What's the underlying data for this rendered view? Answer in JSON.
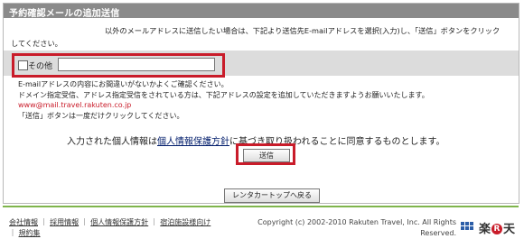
{
  "section": {
    "title": "予約確認メールの追加送信",
    "intro_line1": "以外のメールアドレスに送信したい場合は、下記より送信先E-mailアドレスを選択(入力)し、「送信」ボタンをクリック",
    "intro_line2": "してください。"
  },
  "other_option": {
    "label": "その他",
    "value": "",
    "checked": false
  },
  "notes": {
    "line1": "E-mailアドレスの内容にお間違いがないかよくご確認ください。",
    "line2": "ドメイン指定受信、アドレス指定受信をされている方は、下記アドレスの設定を追加していただきますようお願いいたします。",
    "email": "www@mail.travel.rakuten.co.jp",
    "line4": "「送信」ボタンは一度だけクリックしてください。"
  },
  "consent": {
    "before": "入力された個人情報は",
    "link": "個人情報保護方針",
    "after": "に基づき取り扱われることに同意するものとします。"
  },
  "buttons": {
    "send": "送信",
    "back": "レンタカートップへ戻る"
  },
  "footer": {
    "links": [
      "会社情報",
      "採用情報",
      "個人情報保護方針",
      "宿泊施設様向け",
      "規約集"
    ],
    "copyright_line1": "Copyright (c) 2002-2010 Rakuten Travel, Inc. All Rights",
    "copyright_line2": "Reserved.",
    "logo_text_left": "楽",
    "logo_r": "R",
    "logo_text_right": "天"
  },
  "colors": {
    "highlight_red": "#c91c2a",
    "title_bar": "#8a8a8a",
    "footer_rule": "#7fb54c",
    "link_navy": "#001c6b"
  }
}
